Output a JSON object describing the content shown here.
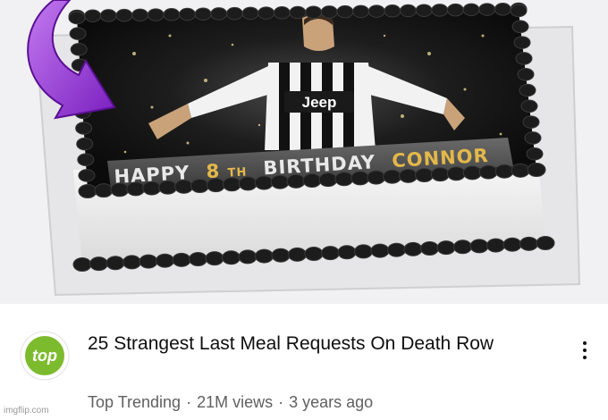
{
  "thumbnail": {
    "cake_text": {
      "happy": "HAPPY",
      "eighth": "8",
      "th": "TH",
      "birthday": "BIRTHDAY",
      "name": "CONNOR"
    },
    "jersey_sponsor": "Jeep",
    "arrow_icon": "curved-arrow-icon",
    "colors": {
      "arrow": "#9b2fd6",
      "frosting": "#1a1a1a",
      "cake_side": "#f4f4f4",
      "board": "#e4e4e6"
    }
  },
  "video": {
    "title": "25 Strangest Last Meal Requests On Death Row",
    "channel": "Top Trending",
    "views": "21M views",
    "age": "3 years ago",
    "separator": "·",
    "channel_logo_text": "top",
    "channel_logo_color": "#7dbb2e"
  },
  "menu_icon": "more-vertical-icon",
  "watermark": "imgflip.com"
}
